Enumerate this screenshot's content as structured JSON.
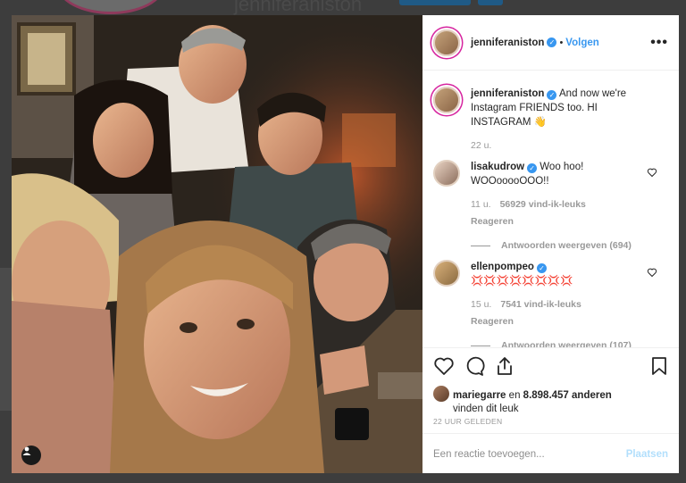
{
  "background": {
    "profile_name": "jenniferaniston"
  },
  "post": {
    "author": "jenniferaniston",
    "separator": "•",
    "follow_label": "Volgen",
    "more_label": "•••",
    "caption": {
      "username": "jenniferaniston",
      "text": "And now we're Instagram FRIENDS too. HI INSTAGRAM 👋",
      "time": "22 u."
    },
    "comments": [
      {
        "username": "lisakudrow",
        "text": "Woo hoo! WOOooooOOO!!",
        "time": "11 u.",
        "likes": "56929 vind-ik-leuks",
        "reply_label": "Reageren",
        "view_replies": "Antwoorden weergeven (694)"
      },
      {
        "username": "ellenpompeo",
        "text": "💢💢💢💢💢💢💢💢",
        "time": "15 u.",
        "likes": "7541 vind-ik-leuks",
        "reply_label": "Reageren",
        "view_replies": "Antwoorden weergeven (107)"
      }
    ],
    "liked_by": {
      "user": "mariegarre",
      "middle": "en",
      "count": "8.898.457 anderen",
      "suffix": "vinden dit leuk"
    },
    "timestamp": "22 UUR GELEDEN",
    "comment_placeholder": "Een reactie toevoegen...",
    "post_button": "Plaatsen"
  },
  "icons": [
    "heart-icon",
    "comment-icon",
    "share-icon",
    "bookmark-icon",
    "user-tag-icon",
    "verified-icon",
    "more-icon"
  ],
  "colors": {
    "accent": "#3897f0",
    "post_disabled": "#b2dffc",
    "muted": "#999999"
  }
}
